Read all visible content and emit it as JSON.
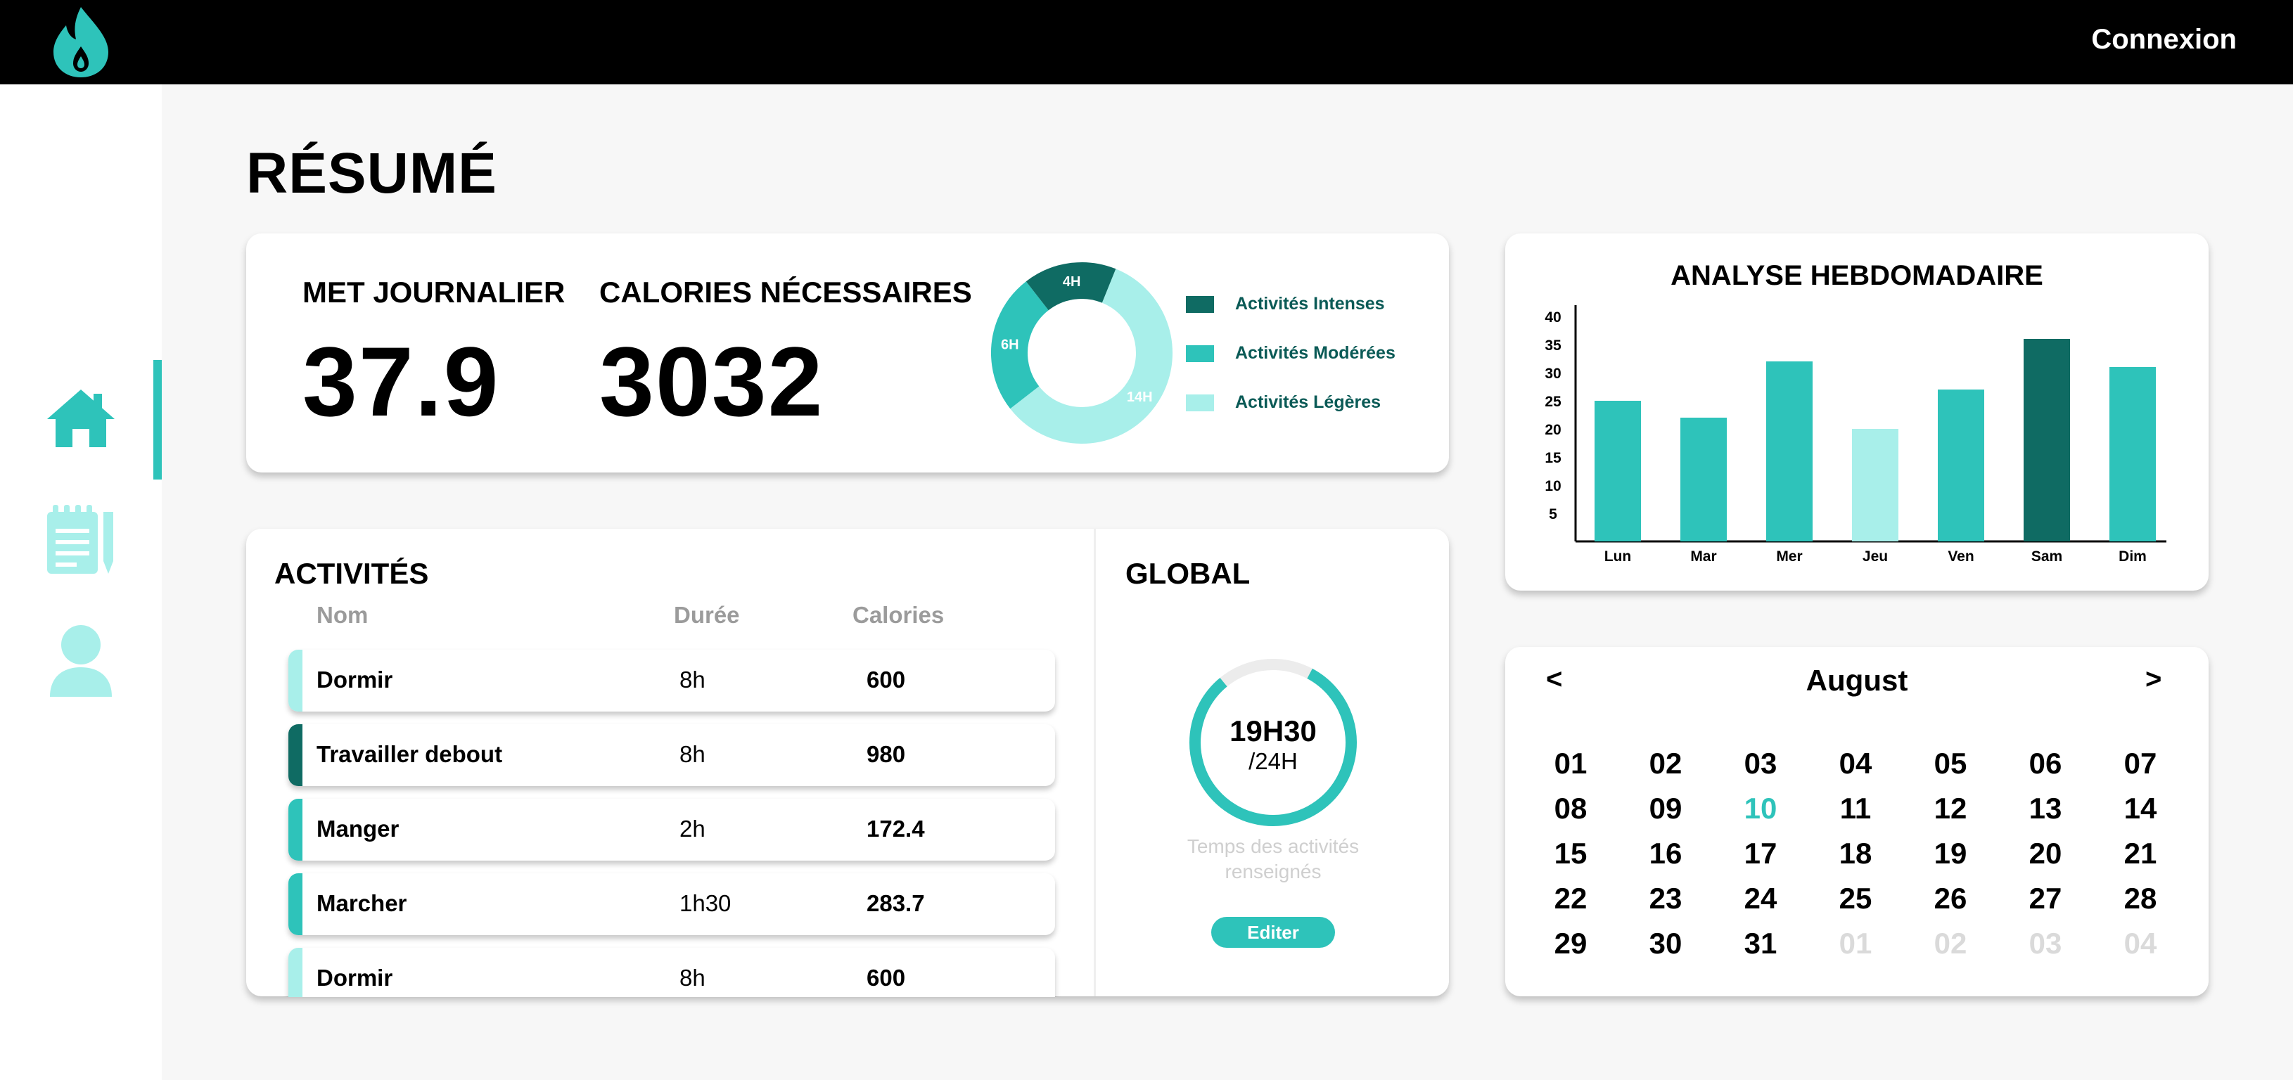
{
  "header": {
    "login_label": "Connexion"
  },
  "page": {
    "title": "RÉSUMÉ"
  },
  "summary": {
    "met_label": "MET JOURNALIER",
    "met_value": "37.9",
    "calories_label": "CALORIES NÉCESSAIRES",
    "calories_value": "3032",
    "donut": {
      "segments": [
        {
          "label": "14H",
          "hours": 14,
          "color": "#a8efea"
        },
        {
          "label": "6H",
          "hours": 6,
          "color": "#2ec3ba"
        },
        {
          "label": "4H",
          "hours": 4,
          "color": "#0f6b63"
        }
      ]
    },
    "legend": [
      {
        "label": "Activités Intenses",
        "color": "#0f6b63"
      },
      {
        "label": "Activités Modérées",
        "color": "#2ec3ba"
      },
      {
        "label": "Activités Légères",
        "color": "#a8efea"
      }
    ]
  },
  "activities": {
    "title": "ACTIVITÉS",
    "columns": {
      "name": "Nom",
      "duration": "Durée",
      "calories": "Calories"
    },
    "rows": [
      {
        "name": "Dormir",
        "duration": "8h",
        "calories": "600",
        "color": "#a8efea"
      },
      {
        "name": "Travailler debout",
        "duration": "8h",
        "calories": "980",
        "color": "#0f6b63"
      },
      {
        "name": "Manger",
        "duration": "2h",
        "calories": "172.4",
        "color": "#2ec3ba"
      },
      {
        "name": "Marcher",
        "duration": "1h30",
        "calories": "283.7",
        "color": "#2ec3ba"
      },
      {
        "name": "Dormir",
        "duration": "8h",
        "calories": "600",
        "color": "#a8efea"
      }
    ]
  },
  "global": {
    "title": "GLOBAL",
    "value": "19H30",
    "total": "/24H",
    "progress": 0.8125,
    "caption_line1": "Temps des activités",
    "caption_line2": "renseignés",
    "edit_label": "Editer"
  },
  "chart_data": {
    "type": "bar",
    "title": "ANALYSE HEBDOMADAIRE",
    "categories": [
      "Lun",
      "Mar",
      "Mer",
      "Jeu",
      "Ven",
      "Sam",
      "Dim"
    ],
    "values": [
      25,
      22,
      32,
      20,
      27,
      36,
      31
    ],
    "colors": [
      "#2ec3ba",
      "#2ec3ba",
      "#2ec3ba",
      "#a8efea",
      "#2ec3ba",
      "#0f6b63",
      "#2ec3ba"
    ],
    "yticks": [
      5,
      10,
      15,
      20,
      25,
      30,
      35,
      40
    ],
    "ylim": [
      0,
      42
    ],
    "grid": false
  },
  "calendar": {
    "month": "August",
    "prev_label": "<",
    "next_label": ">",
    "days": [
      "01",
      "02",
      "03",
      "04",
      "05",
      "06",
      "07",
      "08",
      "09",
      "10",
      "11",
      "12",
      "13",
      "14",
      "15",
      "16",
      "17",
      "18",
      "19",
      "20",
      "21",
      "22",
      "23",
      "24",
      "25",
      "26",
      "27",
      "28",
      "29",
      "30",
      "31",
      "01",
      "02",
      "03",
      "04"
    ],
    "today_index": 9,
    "muted_from_index": 31
  },
  "colors": {
    "accent": "#2ec3ba",
    "dark": "#0f6b63",
    "light": "#a8efea"
  }
}
